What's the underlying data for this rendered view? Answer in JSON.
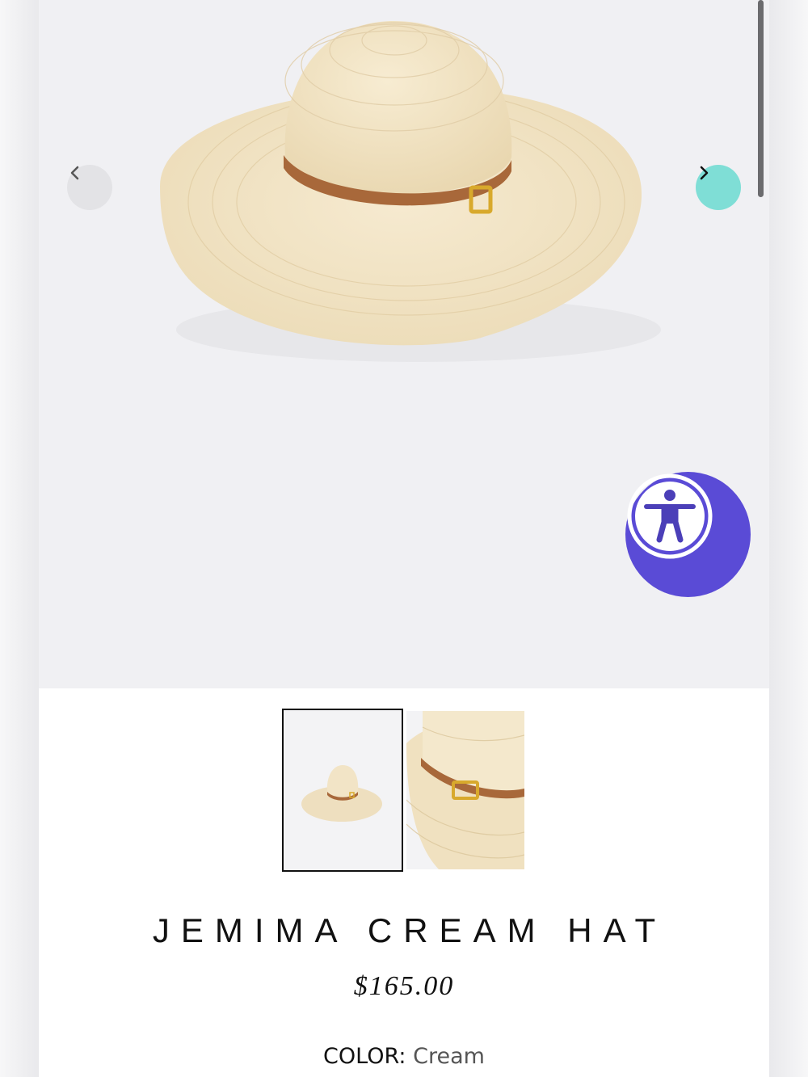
{
  "product": {
    "title": "JEMIMA CREAM HAT",
    "price": "$165.00",
    "color_label": "COLOR:",
    "color_value": "Cream"
  },
  "gallery": {
    "prev_icon": "chevron-left-icon",
    "next_icon": "chevron-right-icon",
    "thumbnails": [
      {
        "name": "thumbnail-full-hat",
        "selected": true
      },
      {
        "name": "thumbnail-hat-closeup",
        "selected": false
      }
    ]
  },
  "accessibility": {
    "icon": "accessibility-person-icon"
  },
  "colors": {
    "straw": "#f2e4c6",
    "band": "#a8683a",
    "buckle": "#d8a92c",
    "accent_next": "#7fded6",
    "accessibility": "#5a4bd6"
  }
}
